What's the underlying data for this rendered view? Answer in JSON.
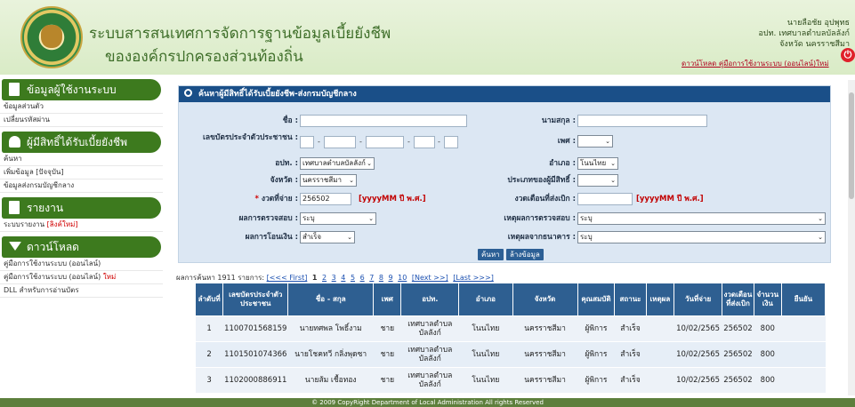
{
  "header": {
    "title_line1": "ระบบสารสนเทศการจัดการฐานข้อมูลเบี้ยยังชีพ",
    "title_line2": "ขององค์กรปกครองส่วนท้องถิ่น",
    "user_name": "นายลือชัย อุปพุทธ",
    "user_org": "อปท. เทศบาลตำบลบัลลังก์",
    "user_province": "จังหวัด นครราชสีมา",
    "download_link": "ดาวน์โหลด คู่มือการใช้งานระบบ (ออนไลน์)ใหม่",
    "logout_icon": "power-icon"
  },
  "sidebar": {
    "sections": [
      {
        "title": "ข้อมูลผู้ใช้งานระบบ",
        "icon": "document-icon",
        "items": [
          {
            "label": "ข้อมูลส่วนตัว",
            "new": ""
          },
          {
            "label": "เปลี่ยนรหัสผ่าน",
            "new": ""
          }
        ]
      },
      {
        "title": "ผู้มีสิทธิ์ได้รับเบี้ยยังชีพ",
        "icon": "add-user-icon",
        "items": [
          {
            "label": "ค้นหา",
            "new": ""
          },
          {
            "label": "เพิ่มข้อมูล [ปัจจุบัน]",
            "new": ""
          },
          {
            "label": "ข้อมูลส่งกรมบัญชีกลาง",
            "new": ""
          }
        ]
      },
      {
        "title": "รายงาน",
        "icon": "report-icon",
        "items": [
          {
            "label": "ระบบรายงาน ",
            "new": "[ลิงค์ใหม่]"
          }
        ]
      },
      {
        "title": "ดาวน์โหลด",
        "icon": "download-icon",
        "items": [
          {
            "label": "คู่มือการใช้งานระบบ (ออนไลน์)",
            "new": ""
          },
          {
            "label": "คู่มือการใช้งานระบบ (ออนไลน์) ",
            "new": "ใหม่"
          },
          {
            "label": "DLL สำหรับการอ่านบัตร",
            "new": ""
          }
        ]
      }
    ]
  },
  "search": {
    "title": "ค้นหาผู้มีสิทธิ์ได้รับเบี้ยยังชีพ-ส่งกรมบัญชีกลาง",
    "labels": {
      "first_name": "ชื่อ :",
      "last_name": "นามสกุล :",
      "id_card": "เลขบัตรประจำตัวประชาชน :",
      "gender": "เพศ :",
      "org": "อปท. :",
      "district": "อำเภอ :",
      "province": "จังหวัด :",
      "type": "ประเภทของผู้มีสิทธิ์ :",
      "pay_period": "งวดที่จ่าย :",
      "month_start": "งวดเดือนที่ส่งเบิก :",
      "check_result": "ผลการตรวจสอบ :",
      "check_reason": "เหตุผลการตรวจสอบ :",
      "transfer_result": "ผลการโอนเงิน :",
      "bank_reason": "เหตุผลจากธนาคาร :"
    },
    "values": {
      "first_name": "",
      "last_name": "",
      "gender": "",
      "org": "เทศบาลตำบลบัลลังก์",
      "district": "โนนไทย",
      "province": "นครราชสีมา",
      "type": "",
      "pay_period": "256502",
      "month_start": "",
      "check_result": "ระบุ",
      "check_reason": "ระบุ",
      "transfer_result": "สำเร็จ",
      "bank_reason": "ระบุ"
    },
    "required_mark": "*",
    "date_hint": "[yyyyMM ปี พ.ศ.]",
    "search_button": "ค้นหา",
    "clear_button": "ล้างข้อมูล"
  },
  "results": {
    "summary": "ผลการค้นหา 1911 รายการ:",
    "first": "[<<< First]",
    "current_page": "1",
    "pages": [
      "2",
      "3",
      "4",
      "5",
      "6",
      "7",
      "8",
      "9",
      "10"
    ],
    "next": "[Next >>]",
    "last": "[Last >>>]",
    "columns": [
      "ลำดับที่",
      "เลขบัตรประจำตัวประชาชน",
      "ชื่อ - สกุล",
      "เพศ",
      "อปท.",
      "อำเภอ",
      "จังหวัด",
      "คุณสมบัติ",
      "สถานะ",
      "เหตุผล",
      "วันที่จ่าย",
      "งวดเดือนที่ส่งเบิก",
      "จำนวนเงิน",
      "ยืนยัน"
    ],
    "rows": [
      [
        "1",
        "1100701568159",
        "นายทศพล โพธิ์งาม",
        "ชาย",
        "เทศบาลตำบลบัลลังก์",
        "โนนไทย",
        "นครราชสีมา",
        "ผู้พิการ",
        "สำเร็จ",
        "",
        "10/02/2565",
        "256502",
        "800",
        ""
      ],
      [
        "2",
        "1101501074366",
        "นายโชคทวี กลิ่งพุดซา",
        "ชาย",
        "เทศบาลตำบลบัลลังก์",
        "โนนไทย",
        "นครราชสีมา",
        "ผู้พิการ",
        "สำเร็จ",
        "",
        "10/02/2565",
        "256502",
        "800",
        ""
      ],
      [
        "3",
        "1102000886911",
        "นายส้ม เชื้อทอง",
        "ชาย",
        "เทศบาลตำบลบัลลังก์",
        "โนนไทย",
        "นครราชสีมา",
        "ผู้พิการ",
        "สำเร็จ",
        "",
        "10/02/2565",
        "256502",
        "800",
        ""
      ]
    ]
  },
  "footer": {
    "text": "© 2009 CopyRight Department of Local Administration All rights Reserved"
  },
  "colors": {
    "header_green": "#3f6f2a",
    "sidebar_green": "#3d7a1e",
    "panel_blue": "#1a4f88",
    "table_head": "#2e5f91",
    "alert_red": "#d00000"
  }
}
